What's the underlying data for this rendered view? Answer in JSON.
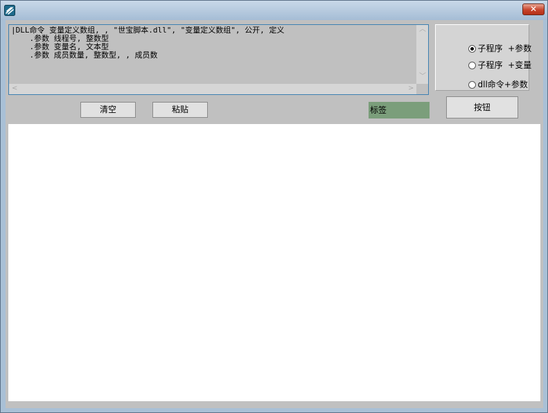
{
  "window": {
    "app_icon": "app-logo-icon",
    "close_glyph": "✕"
  },
  "code_editor": {
    "text": "|DLL命令 变量定义数组, , \"世宝脚本.dll\", \"变量定义数组\", 公开, 定义\n    .参数 线程号, 整数型\n    .参数 变量名, 文本型\n    .参数 成员数量, 整数型, , 成员数"
  },
  "radio_group": {
    "options": [
      {
        "label": "子程序  +参数",
        "checked": true
      },
      {
        "label": "子程序  +变量",
        "checked": false
      },
      {
        "label": "dll命令+参数",
        "checked": false
      }
    ]
  },
  "buttons": {
    "clear": "清空",
    "paste": "粘贴",
    "action": "按钮"
  },
  "label": {
    "text": "标签",
    "background": "#7b9e7b"
  },
  "colors": {
    "title_bar": "#a9c0d6",
    "client_bg": "#c0c0c0",
    "close_button": "#c7442c",
    "editor_border": "#3c7fb1"
  }
}
